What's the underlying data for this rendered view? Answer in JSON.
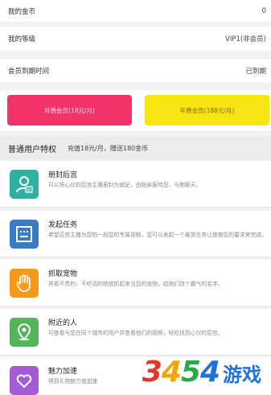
{
  "account": {
    "coins_label": "我的金币",
    "coins_value": "0",
    "level_label": "我的等级",
    "level_value": "VIP1(非会员)",
    "expire_label": "会员到期时间",
    "expire_value": "已到期"
  },
  "buttons": {
    "monthly": "月费会员(18元/月)",
    "yearly": "年费会员(188元/月)"
  },
  "privileges": {
    "title": "普通用户特权",
    "note": "充值18元/月，赠送180金币",
    "items": [
      {
        "title": "册封后宫",
        "desc": "可以将心仪的后宫主播册封为嫔妃，由她亲服侍您，与她聊天。",
        "icon": "user-crown-icon",
        "color": "#2fb1a2"
      },
      {
        "title": "发起任务",
        "desc": "希望后宫主播为您拍一段您的专属视频，您可以发起一个悬赏任务让她按您的要求来完成。",
        "icon": "task-list-icon",
        "color": "#3a7bc8"
      },
      {
        "title": "抓取宠物",
        "desc": "将看不贵的，不听话的统统抓起来当您的宠物，给他们改个霸气的名字。",
        "icon": "paw-hand-icon",
        "color": "#f39a1c"
      },
      {
        "title": "附近的人",
        "desc": "可查看与您在同个城市的用户并查看他们的视频，轻松找到心仪的后宫。",
        "icon": "location-pin-icon",
        "color": "#54b45a"
      },
      {
        "title": "魅力加速",
        "desc": "得到礼物魅力值加速",
        "icon": "heart-icon",
        "color": "#a55ad6"
      }
    ]
  },
  "watermark": {
    "digits": "3454",
    "text": "游戏"
  }
}
